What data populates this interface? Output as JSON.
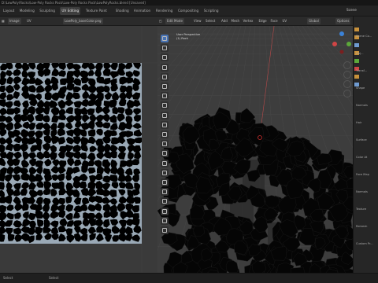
{
  "window": {
    "title": "D:\\LowPoly\\Rocks\\Low-Poly Rocks Pack\\Low-Poly Rocks Pack\\LowPolyRocks.blend [Unsaved]"
  },
  "workspaces": [
    "Layout",
    "Modeling",
    "Sculpting",
    "UV Editing",
    "Texture Paint",
    "Shading",
    "Animation",
    "Rendering",
    "Compositing",
    "Scripting"
  ],
  "active_workspace": "UV Editing",
  "scene": {
    "label": "Scene"
  },
  "uv_editor": {
    "mode_label": "Image",
    "view_label": "UV",
    "image_name": "LowPoly_baseColor.png"
  },
  "viewport": {
    "mode_label": "Edit Mode",
    "menus": [
      "View",
      "Select",
      "Add",
      "Mesh",
      "Vertex",
      "Edge",
      "Face",
      "UV"
    ],
    "orientation_label": "Global",
    "options_label": "Options",
    "view_name": "User Perspective",
    "object_name": "(1) Rock"
  },
  "properties": {
    "items": [
      "Scene Co...",
      "Obj...",
      "Transf...",
      "Shape",
      "Normals",
      "Hair",
      "Surface",
      "Color At",
      "Face Map",
      "Normals",
      "Texture",
      "Remesh",
      "Custom Pr..."
    ]
  },
  "status": {
    "left_label": "Select",
    "right_label": "Select"
  },
  "colors": {
    "accent": "#4772b3",
    "uv_background": "#9aa9b6",
    "rock": "#000000"
  }
}
